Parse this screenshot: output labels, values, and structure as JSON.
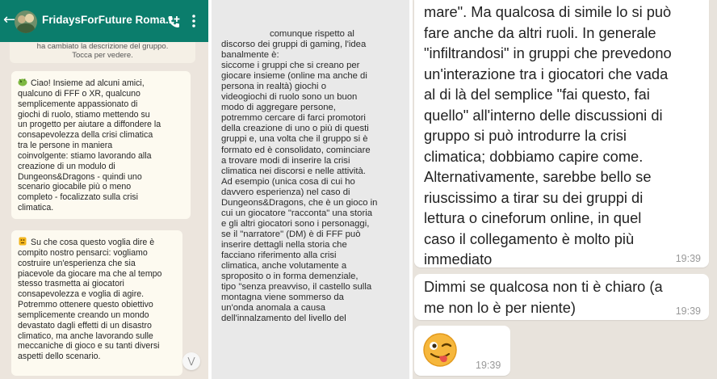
{
  "colors": {
    "header": "#0b7d6c",
    "chat_bg": "#ece5dd",
    "bubble_in": "#fdfaf0",
    "bubble_white": "#ffffff"
  },
  "panel1": {
    "header": {
      "title": "FridaysForFuture Roma...",
      "back_icon": "back-arrow-icon",
      "call_icon": "call-add-icon",
      "menu_icon": "more-vert-icon"
    },
    "system_note": [
      "ha cambiato la descrizione del gruppo.",
      "Tocca per vedere."
    ],
    "message1_lines": [
      "Ciao! Insieme ad alcuni amici,",
      "qualcuno di FFF o XR, qualcuno",
      "semplicemente appassionato di",
      "giochi di ruolo, stiamo mettendo su",
      "un progetto per aiutare a diffondere la",
      "consapevolezza della crisi climatica",
      "tra le persone in maniera",
      "coinvolgente: stiamo lavorando alla",
      "creazione di un modulo di",
      "Dungeons&Dragons - quindi uno",
      "scenario giocabile più o meno",
      "completo - focalizzato sulla crisi",
      "climatica."
    ],
    "message2_lines": [
      "Su che cosa questo voglia dire è",
      "compito nostro pensarci: vogliamo",
      "costruire un'esperienza che sia",
      "piacevole da giocare ma che al tempo",
      "stesso trasmetta ai giocatori",
      "consapevolezza e voglia di agire.",
      "Potremmo ottenere questo obiettivo",
      "semplicemente creando un mondo",
      "devastato dagli effetti di un disastro",
      "climatico, ma anche lavorando sulle",
      "meccaniche di gioco e su tanti diversi",
      "aspetti dello scenario."
    ],
    "scroll_down_icon": "chevron-double-down-icon"
  },
  "panel2": {
    "lines": [
      "comunque rispetto al",
      "discorso dei gruppi di gaming, l'idea",
      "banalmente è:",
      "siccome i gruppi che si creano per",
      "giocare insieme (online ma anche di",
      "persona in realtà) giochi o",
      "videogiochi di ruolo sono un buon",
      "modo di aggregare persone,",
      "potremmo cercare di farci promotori",
      "della creazione di uno o più di questi",
      "gruppi e, una volta che il gruppo si è",
      "formato ed è consolidato, cominciare",
      "a trovare modi di inserire la crisi",
      "climatica nei discorsi e nelle attività.",
      "Ad esempio (unica cosa di cui ho",
      "davvero esperienza) nel caso di",
      "Dungeons&Dragons, che è un gioco in",
      "cui un giocatore \"racconta\" una storia",
      "e gli altri giocatori sono i personaggi,",
      "se il \"narratore\" (DM) è di FFF può",
      "inserire dettagli nella storia che",
      "facciano riferimento alla crisi",
      "climatica, anche volutamente a",
      "sproposito o in forma demenziale,",
      "tipo \"senza preavviso, il castello sulla",
      "montagna viene sommerso da",
      "un'onda anomala a causa",
      "dell'innalzamento del livello del"
    ]
  },
  "panel3": {
    "msg1_lines": [
      "mare\". Ma qualcosa di simile lo si può",
      "fare anche da altri ruoli. In generale",
      "\"infiltrandosi\" in gruppi che prevedono",
      "un'interazione tra i giocatori che vada",
      "al di là del semplice \"fai questo, fai",
      "quello\" all'interno delle discussioni di",
      "gruppo si può introdurre la crisi",
      "climatica; dobbiamo capire come.",
      "Alternativamente, sarebbe bello se",
      "riuscissimo a tirar su dei gruppi di",
      "lettura o cineforum online, in quel",
      "caso il collegamento è molto più",
      "immediato"
    ],
    "msg1_time": "19:39",
    "msg2_lines": [
      "Dimmi se qualcosa non ti è chiaro (a",
      "me non lo è per niente)"
    ],
    "msg2_time": "19:39",
    "msg3_emoji": "winking-tongue-emoji",
    "msg3_time": "19:39"
  }
}
